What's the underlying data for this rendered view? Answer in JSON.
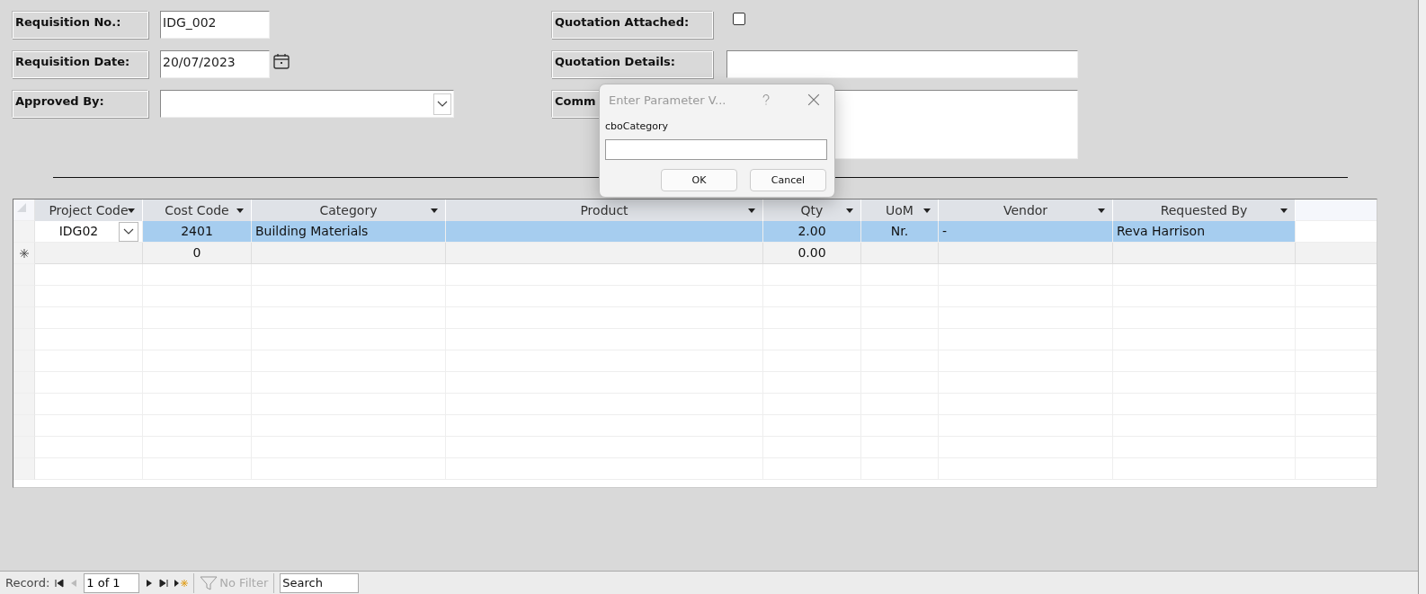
{
  "form_left": [
    {
      "label": "Requisition No.:",
      "kind": "text",
      "value": "IDG_002"
    },
    {
      "label": "Requisition Date:",
      "kind": "date",
      "value": "20/07/2023"
    },
    {
      "label": "Approved By:",
      "kind": "combo"
    }
  ],
  "form_right": [
    {
      "label": "Quotation Attached:",
      "kind": "checkbox",
      "checked": false
    },
    {
      "label": "Quotation Details:",
      "kind": "text"
    },
    {
      "label": "Comm",
      "kind": "textarea"
    }
  ],
  "dialog": {
    "title": "Enter Parameter V...",
    "prompt": "cboCategory",
    "buttons": [
      "OK",
      "Cancel"
    ]
  },
  "table": {
    "columns": [
      "Project Code",
      "Cost Code",
      "Category",
      "Product",
      "Qty",
      "UoM",
      "Vendor",
      "Requested By"
    ],
    "rows": [
      {
        "kind": "record",
        "selected": true,
        "cells": [
          "IDG02",
          "2401",
          "Building Materials",
          "",
          "2.00",
          "Nr.",
          "-",
          "Reva Harrison"
        ]
      },
      {
        "kind": "new",
        "selected": false,
        "cells": [
          "",
          "0",
          "",
          "",
          "0.00",
          "",
          "",
          ""
        ]
      }
    ]
  },
  "navigation": {
    "label": "Record:",
    "position": "1 of 1",
    "filter": "No Filter",
    "filter_disabled": true,
    "search": "Search"
  }
}
